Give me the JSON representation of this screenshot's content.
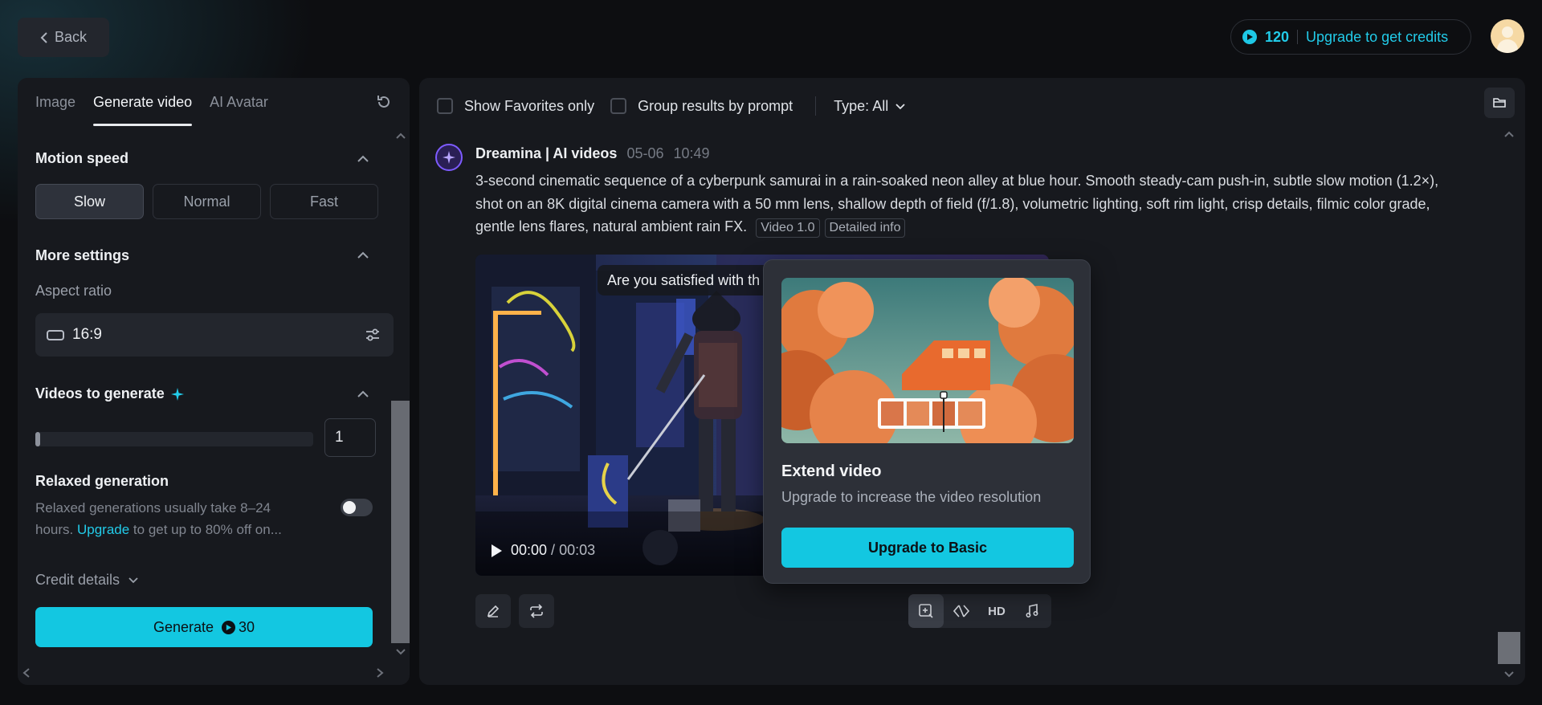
{
  "topbar": {
    "back_label": "Back",
    "credits": "120",
    "upgrade_label": "Upgrade to get credits"
  },
  "left": {
    "tabs": [
      {
        "label": "Image"
      },
      {
        "label": "Generate video"
      },
      {
        "label": "AI Avatar"
      }
    ],
    "motion_speed": {
      "title": "Motion speed",
      "options": [
        "Slow",
        "Normal",
        "Fast"
      ],
      "selected": "Slow"
    },
    "more_settings": {
      "title": "More settings",
      "aspect_label": "Aspect ratio",
      "aspect_value": "16:9"
    },
    "videos_to_generate": {
      "title": "Videos to generate",
      "value": "1"
    },
    "relaxed": {
      "title": "Relaxed generation",
      "desc_before": "Relaxed generations usually take 8–24 hours. ",
      "desc_link": "Upgrade",
      "desc_after": " to get up to 80% off on...",
      "enabled": false
    },
    "credit_details_label": "Credit details",
    "generate_label": "Generate",
    "generate_cost": "30"
  },
  "main": {
    "filters": {
      "favorites_label": "Show Favorites only",
      "group_label": "Group results by prompt",
      "type_label": "Type: All"
    },
    "generation": {
      "author": "Dreamina | AI videos",
      "date": "05-06",
      "time": "10:49",
      "prompt": "3-second cinematic sequence of a cyberpunk samurai in a rain-soaked neon alley at blue hour. Smooth steady-cam push-in, subtle slow motion (1.2×), shot on an 8K digital cinema camera with a 50 mm lens, shallow depth of field (f/1.8), volumetric lighting, soft rim light, crisp details, filmic color grade, gentle lens flares, natural ambient rain FX.",
      "tags": [
        "Video 1.0",
        "Detailed info"
      ],
      "video": {
        "satisfied_text": "Are you satisfied with th",
        "current_time": "00:00",
        "duration": "00:03"
      },
      "tools": {
        "hd_label": "HD"
      }
    }
  },
  "popover": {
    "title": "Extend video",
    "desc": "Upgrade to increase the video resolution",
    "button_label": "Upgrade to Basic"
  },
  "colors": {
    "accent": "#13c7e1",
    "panel": "#17191e",
    "background": "#0d0e11"
  }
}
